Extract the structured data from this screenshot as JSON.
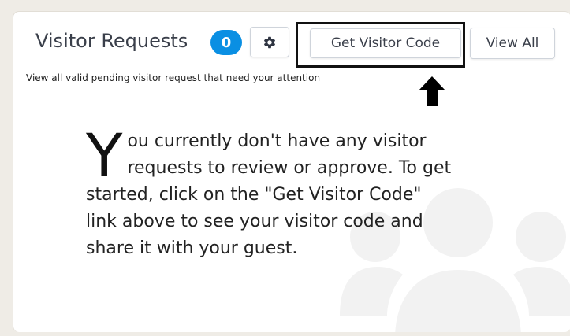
{
  "widget": {
    "title": "Visitor Requests",
    "badge_count": "0",
    "subtitle": "View all valid pending visitor request that need your attention",
    "buttons": {
      "settings_icon": "gear-icon",
      "get_visitor_code": "Get Visitor Code",
      "view_all": "View All"
    },
    "empty_state": {
      "dropcap": "Y",
      "line1": "ou currently don't have any visitor",
      "line2": "requests to review or approve. To get",
      "line3": "started, click on the \"Get Visitor Code\"",
      "line4": "link above to see your visitor code and",
      "line5": "share it with your guest."
    },
    "icons": {
      "arrow": "arrow-up-icon",
      "background": "people-group-icon"
    },
    "colors": {
      "badge": "#0a8fe3",
      "page_background": "#efece6",
      "card": "#ffffff",
      "highlight_box": "#111111",
      "watermark_icon": "#f2f2f2"
    }
  }
}
